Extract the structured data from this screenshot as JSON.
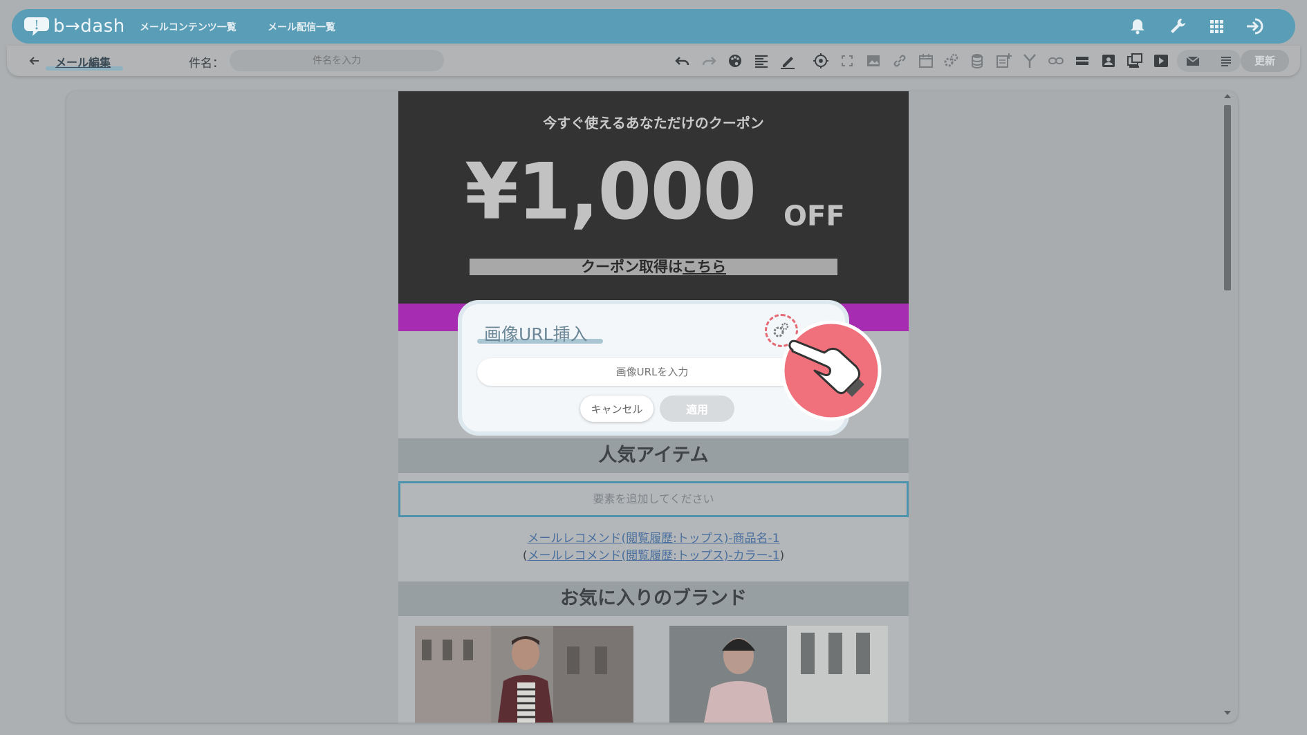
{
  "app": {
    "logo_text": "b→dash",
    "nav": [
      "メールコンテンツ一覧",
      "メール配信一覧"
    ],
    "nav_icons": [
      "bell-icon",
      "wrench-icon",
      "apps-grid-icon",
      "logout-icon"
    ]
  },
  "toolbar": {
    "page_label": "メール編集",
    "subject_label": "件名：",
    "subject_placeholder": "件名を入力",
    "update_label": "更新",
    "icons": [
      "undo-icon",
      "redo-icon",
      "palette-icon",
      "align-left-icon",
      "pen-icon",
      "target-icon",
      "fullscreen-icon",
      "image-icon",
      "link-icon",
      "calendar-icon",
      "gears-icon",
      "database-icon",
      "add-note-icon",
      "merge-icon",
      "tag-link-icon",
      "bar-block-icon",
      "profile-card-icon",
      "multi-window-icon",
      "play-icon",
      "mail-icon",
      "text-lines-icon"
    ]
  },
  "email": {
    "coupon_subtitle": "今すぐ使えるあなただけのクーポン",
    "coupon_amount": "¥1,000",
    "coupon_off": "OFF",
    "coupon_link_prefix": "クーポン取得は",
    "coupon_link_word": "こちら",
    "section_popular": "人気アイテム",
    "add_element": "要素を追加してください",
    "rec_line1": "メールレコメンド(閲覧履歴:トップス)-商品名-1",
    "rec_line2_open": "(",
    "rec_line2": "メールレコメンド(閲覧履歴:トップス)-カラー-1",
    "rec_line2_close": ")",
    "section_brand": "お気に入りのブランド"
  },
  "dialog": {
    "title": "画像URL挿入",
    "input_placeholder": "画像URLを入力",
    "cancel_label": "キャンセル",
    "apply_label": "適用"
  },
  "colors": {
    "nav_bg": "#5a9db6",
    "coupon_bg": "#333333",
    "accent_purple": "#a62db2",
    "highlight_red": "#f0707c"
  }
}
